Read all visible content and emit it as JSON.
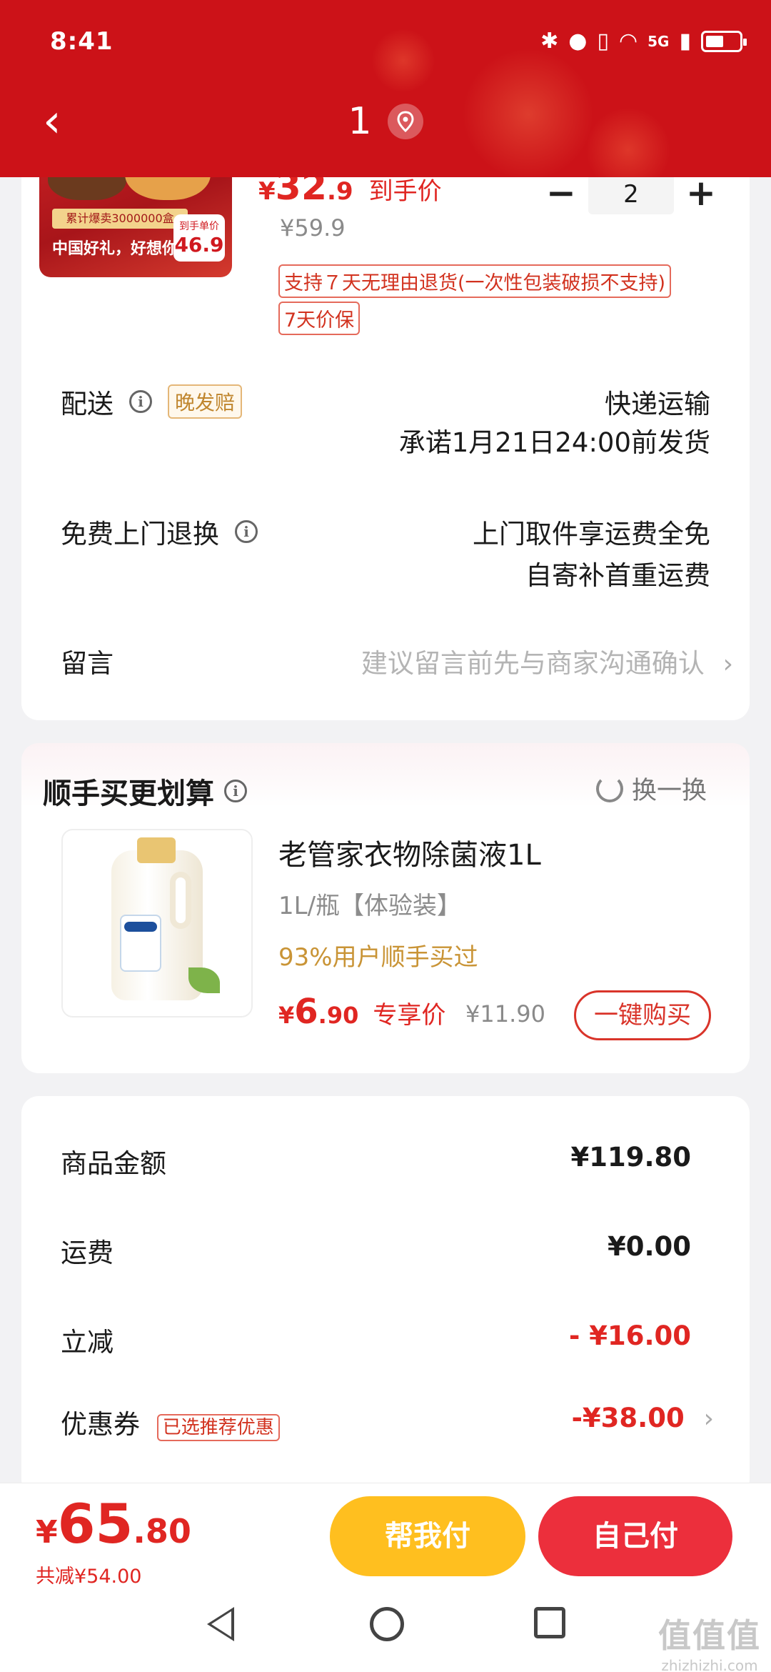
{
  "status_bar": {
    "time": "8:41",
    "icons": [
      "bluetooth-icon",
      "location-icon",
      "vibrate-icon",
      "wifi-icon",
      "5g-signal-icon",
      "battery-icon"
    ],
    "network": "5G"
  },
  "nav": {
    "back_icon": "chevron-left-icon",
    "title": "1",
    "location_icon": "location-pin-icon"
  },
  "colors": {
    "header_red": "#cc1218",
    "price_red": "#e02622",
    "gold": "#c99436",
    "help_pay_yellow": "#ffbf1f",
    "self_pay_red": "#ec2f3c"
  },
  "product": {
    "image_band": "累计爆卖3000000盒",
    "image_slogan": "中国好礼，好想你",
    "image_badge_label": "到手单价",
    "image_badge_value": "46.9",
    "price_currency": "¥",
    "price_int": "32",
    "price_dec": ".9",
    "price_label": "到手价",
    "original_price": "¥59.9",
    "quantity": "2",
    "minus": "−",
    "plus": "+",
    "tags": [
      "支持７天无理由退货(一次性包装破损不支持)",
      "7天价保"
    ]
  },
  "delivery": {
    "label": "配送",
    "chip": "晚发赔",
    "method": "快递运输",
    "promise": "承诺1月21日24:00前发货"
  },
  "returns": {
    "label": "免费上门退换",
    "line1": "上门取件享运费全免",
    "line2": "自寄补首重运费"
  },
  "message": {
    "label": "留言",
    "placeholder": "建议留言前先与商家沟通确认",
    "chevron": "›"
  },
  "addon": {
    "title": "顺手买更划算",
    "swap_label": "换一换",
    "name": "老管家衣物除菌液1L",
    "spec": "1L/瓶【体验装】",
    "bought": "93%用户顺手买过",
    "price_currency": "¥",
    "price_int": "6",
    "price_dec": ".90",
    "price_label": "专享价",
    "original_price": "¥11.90",
    "buy_label": "一键购买"
  },
  "summary": {
    "goods_label": "商品金额",
    "goods_value": "¥119.80",
    "shipping_label": "运费",
    "shipping_value": "¥0.00",
    "discount_label": "立减",
    "discount_value": "- ¥16.00",
    "coupon_label": "优惠券",
    "coupon_chip": "已选推荐优惠",
    "coupon_value": "-¥38.00",
    "coupon_chevron": "›"
  },
  "checkout": {
    "currency": "¥",
    "total_int": "65",
    "total_dec": ".80",
    "saved": "共减¥54.00",
    "help_pay": "帮我付",
    "self_pay": "自己付"
  },
  "system_nav": {
    "back": "back-triangle-icon",
    "home": "home-circle-icon",
    "recents": "recents-square-icon"
  },
  "watermark": {
    "big": "值值值",
    "small": "zhizhizhi.com"
  }
}
